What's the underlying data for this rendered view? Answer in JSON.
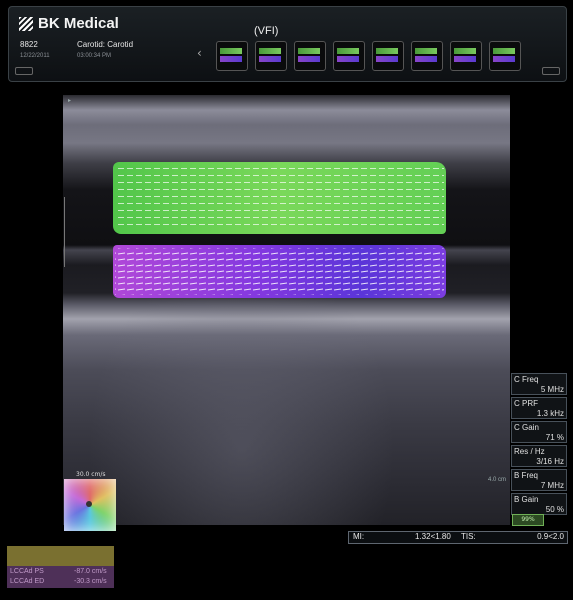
{
  "header": {
    "brand": "BK Medical",
    "patient_id": "8822",
    "date": "12/22/2011",
    "exam": "Carotid: Carotid",
    "time": "03:00:34 PM",
    "mode_label": "(VFI)",
    "nav_left_icon": "chevron-left-icon",
    "thumbnail_count": 8
  },
  "image": {
    "depth_label": "4.0 cm"
  },
  "color_scale": {
    "label": "30.0 cm/s"
  },
  "params": [
    {
      "label": "C Freq",
      "value": "5 MHz"
    },
    {
      "label": "C PRF",
      "value": "1.3 kHz"
    },
    {
      "label": "C Gain",
      "value": "71 %"
    },
    {
      "label": "Res / Hz",
      "value": "3/16 Hz"
    },
    {
      "label": "B Freq",
      "value": "7 MHz"
    },
    {
      "label": "B Gain",
      "value": "50 %"
    }
  ],
  "battery": "99%",
  "indices": {
    "mi_label": "MI:",
    "mi_value": "1.32<1.80",
    "tis_label": "TIS:",
    "tis_value": "0.9<2.0"
  },
  "measurements": [
    {
      "label": "LCCAd PS",
      "value": "-87.0 cm/s"
    },
    {
      "label": "LCCAd ED",
      "value": "-30.3 cm/s"
    }
  ],
  "colors": {
    "accent_green": "#63cf55",
    "accent_purple": "#8238e0",
    "measure_header": "#7a7030",
    "measure_box": "#4e3058"
  }
}
